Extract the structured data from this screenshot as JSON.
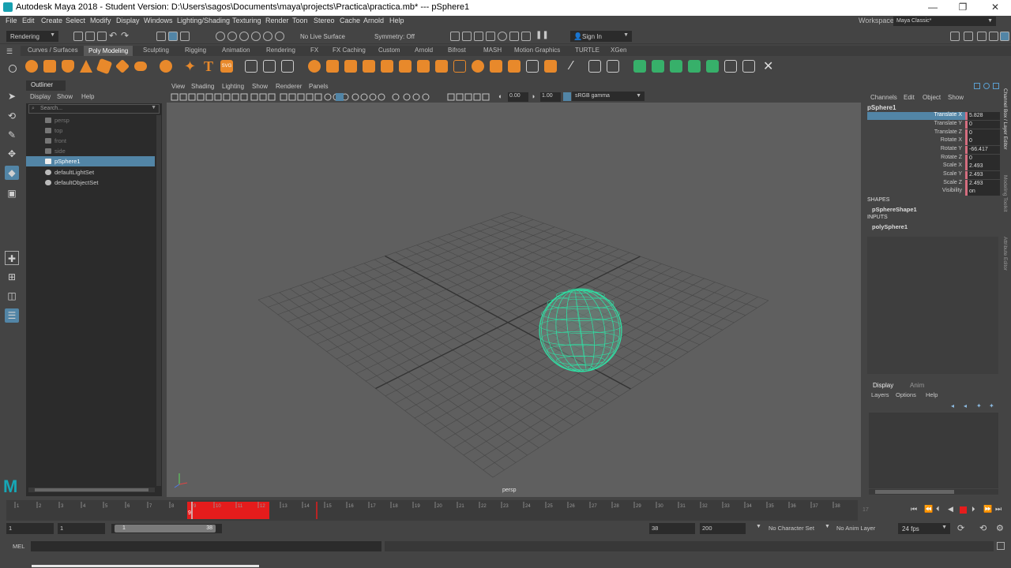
{
  "window": {
    "title": "Autodesk Maya 2018 - Student Version: D:\\Users\\sagos\\Documents\\maya\\projects\\Practica\\practica.mb*   ---   pSphere1",
    "minimize_glyph": "—",
    "maximize_glyph": "❐",
    "close_glyph": "✕"
  },
  "menubar": {
    "items": [
      "File",
      "Edit",
      "Create",
      "Select",
      "Modify",
      "Display",
      "Windows",
      "Lighting/Shading",
      "Texturing",
      "Render",
      "Toon",
      "Stereo",
      "Cache",
      "Arnold",
      "Help"
    ],
    "workspace_label": "Workspace :",
    "workspace_value": "Maya Classic*"
  },
  "statusline": {
    "menuset": "Rendering",
    "live_surface": "No Live Surface",
    "symmetry": "Symmetry: Off",
    "sign_in": "Sign In"
  },
  "shelf": {
    "tabs": [
      "Curves / Surfaces",
      "Poly Modeling",
      "Sculpting",
      "Rigging",
      "Animation",
      "Rendering",
      "FX",
      "FX Caching",
      "Custom",
      "Arnold",
      "Bifrost",
      "MASH",
      "Motion Graphics",
      "TURTLE",
      "XGen"
    ],
    "active_tab": "Poly Modeling",
    "text_icon": "T",
    "svg_icon": "SVG"
  },
  "outliner": {
    "tab": "Outliner",
    "menus": [
      "Display",
      "Show",
      "Help"
    ],
    "search_placeholder": "Search...",
    "items": [
      {
        "label": "persp",
        "state": "hidden"
      },
      {
        "label": "top",
        "state": "hidden"
      },
      {
        "label": "front",
        "state": "hidden"
      },
      {
        "label": "side",
        "state": "hidden"
      },
      {
        "label": "pSphere1",
        "state": "selected"
      },
      {
        "label": "defaultLightSet",
        "state": "normal"
      },
      {
        "label": "defaultObjectSet",
        "state": "normal"
      }
    ]
  },
  "viewport": {
    "menus": [
      "View",
      "Shading",
      "Lighting",
      "Show",
      "Renderer",
      "Panels"
    ],
    "exposure": "0.00",
    "gamma": "1.00",
    "color_space": "sRGB gamma",
    "camera_label": "persp"
  },
  "channelbox": {
    "menus": [
      "Channels",
      "Edit",
      "Object",
      "Show"
    ],
    "object_name": "pSphere1",
    "attributes": [
      {
        "label": "Translate X",
        "value": "5.828",
        "selected": true
      },
      {
        "label": "Translate Y",
        "value": "0"
      },
      {
        "label": "Translate Z",
        "value": "0"
      },
      {
        "label": "Rotate X",
        "value": "0"
      },
      {
        "label": "Rotate Y",
        "value": "-66.417"
      },
      {
        "label": "Rotate Z",
        "value": "0"
      },
      {
        "label": "Scale X",
        "value": "2.493"
      },
      {
        "label": "Scale Y",
        "value": "2.493"
      },
      {
        "label": "Scale Z",
        "value": "2.493"
      },
      {
        "label": "Visibility",
        "value": "on"
      }
    ],
    "shapes_header": "SHAPES",
    "shape_name": "pSphereShape1",
    "inputs_header": "INPUTS",
    "input_name": "polySphere1",
    "side_tabs": [
      "Channel Box / Layer Editor",
      "Modeling Toolkit",
      "Attribute Editor"
    ]
  },
  "layer_editor": {
    "tabs": [
      "Display",
      "Anim"
    ],
    "active_tab": "Display",
    "menus": [
      "Layers",
      "Options",
      "Help"
    ]
  },
  "timeline": {
    "ticks": [
      "1",
      "2",
      "3",
      "4",
      "5",
      "6",
      "7",
      "8",
      "9",
      "10",
      "11",
      "12",
      "13",
      "14",
      "15",
      "16",
      "17",
      "18",
      "19",
      "20",
      "21",
      "22",
      "23",
      "24",
      "25",
      "26",
      "27",
      "28",
      "29",
      "30",
      "31",
      "32",
      "33",
      "34",
      "35",
      "36",
      "37",
      "38"
    ],
    "current_frame": "9",
    "end_marker": "17"
  },
  "range": {
    "start_anim": "1",
    "start_playback": "1",
    "slider_start": "1",
    "slider_end": "38",
    "end_playback": "38",
    "end_anim": "200",
    "character_set": "No Character Set",
    "anim_layer": "No Anim Layer",
    "fps": "24 fps"
  },
  "commandline": {
    "language": "MEL"
  },
  "colors": {
    "accent": "#5285a6",
    "keyed": "#d46d7f",
    "sphere_wire": "#2fe0a4",
    "timeline_key": "#e51c1c"
  }
}
